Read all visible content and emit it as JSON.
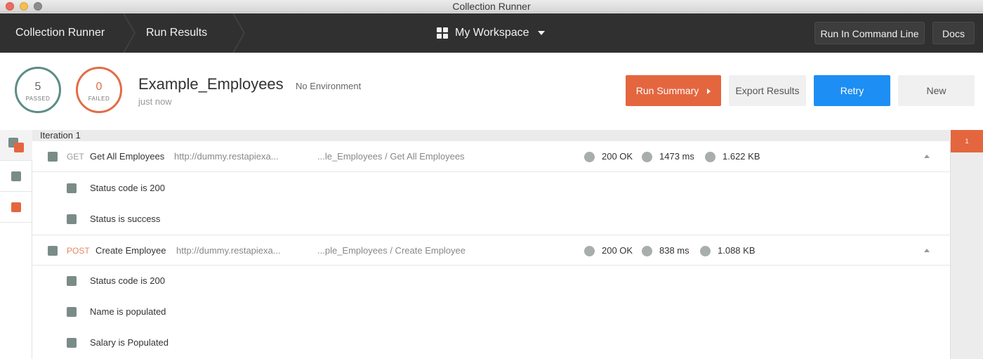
{
  "window": {
    "title": "Collection Runner"
  },
  "nav": {
    "crumbs": [
      "Collection Runner",
      "Run Results"
    ],
    "workspace": "My Workspace",
    "run_cli": "Run In Command Line",
    "docs": "Docs"
  },
  "summary": {
    "passed": {
      "count": "5",
      "label": "PASSED"
    },
    "failed": {
      "count": "0",
      "label": "FAILED"
    },
    "collection": "Example_Employees",
    "environment": "No Environment",
    "when": "just now"
  },
  "actions": {
    "run_summary": "Run Summary",
    "export": "Export Results",
    "retry": "Retry",
    "new": "New"
  },
  "results": {
    "iteration": "Iteration 1",
    "requests": [
      {
        "method": "GET",
        "name": "Get All Employees",
        "url": "http://dummy.restapiexa...",
        "path": "...le_Employees / Get All Employees",
        "status": "200 OK",
        "time": "1473 ms",
        "size": "1.622 KB",
        "tests": [
          "Status code is 200",
          "Status is success"
        ]
      },
      {
        "method": "POST",
        "name": "Create Employee",
        "url": "http://dummy.restapiexa...",
        "path": "...ple_Employees / Create Employee",
        "status": "200 OK",
        "time": "838 ms",
        "size": "1.088 KB",
        "tests": [
          "Status code is 200",
          "Name is populated",
          "Salary is Populated"
        ]
      }
    ]
  },
  "rightbar": {
    "iteration_marker": "1"
  },
  "colors": {
    "accent_orange": "#e4663f",
    "accent_blue": "#1d8ef3",
    "passed_ring": "#5e8c85",
    "nav_bg": "#303030"
  }
}
